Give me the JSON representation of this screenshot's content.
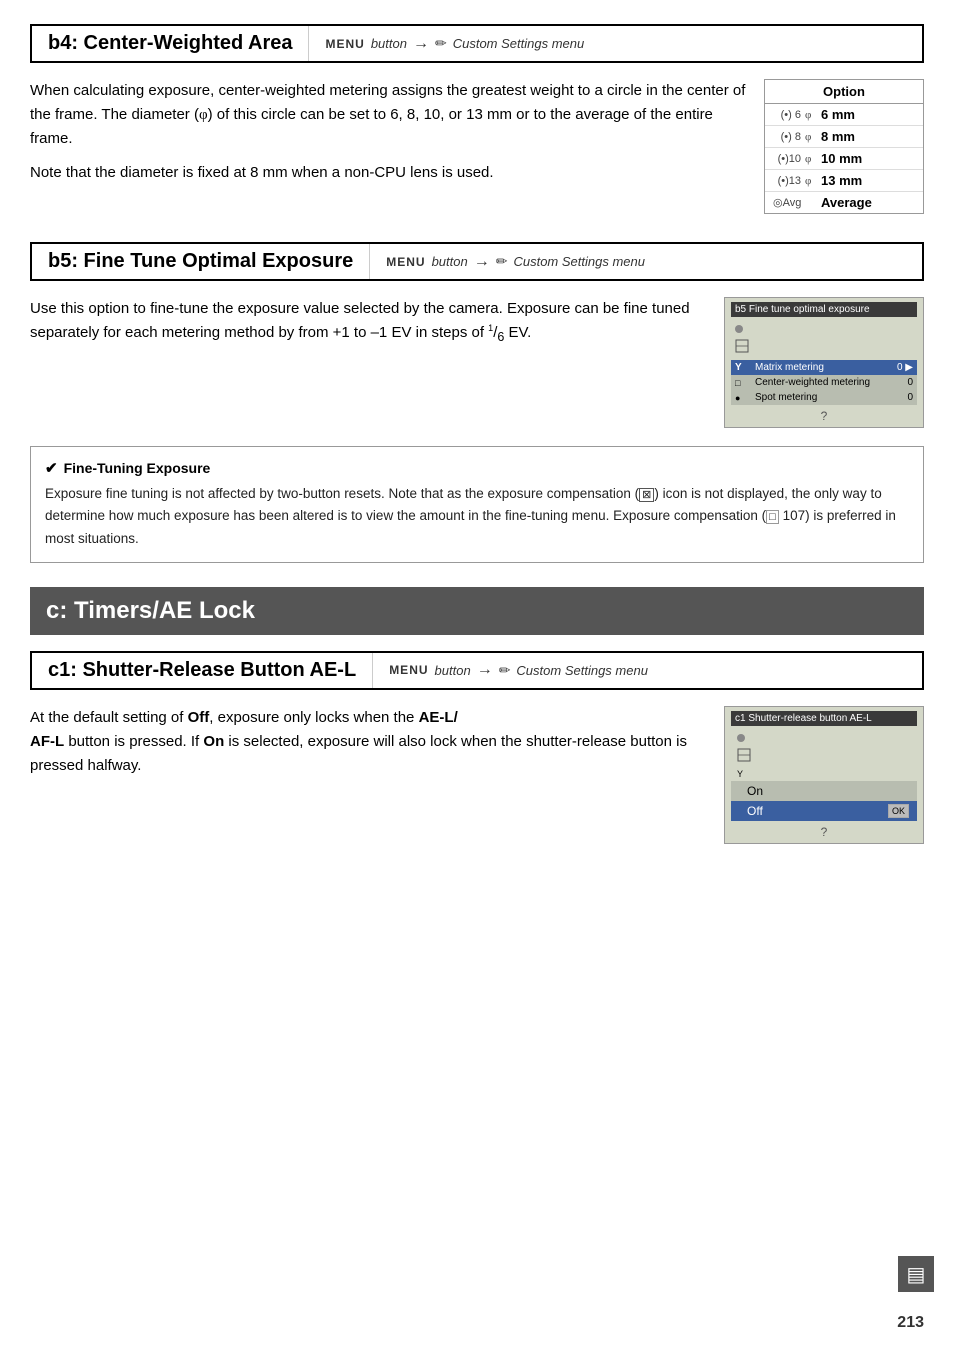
{
  "b4": {
    "title": "b4: Center-Weighted Area",
    "nav": {
      "menu": "MENU",
      "button": "button",
      "arrow": "→",
      "section": "Custom Settings menu"
    },
    "body1": "When calculating exposure, center-weighted metering assigns the greatest weight to a circle in the center of the frame.  The diameter (φ) of this circle can be set to 6, 8, 10, or 13 mm or to the average of the entire frame.",
    "body2": "Note that the diameter is fixed at 8 mm when a non-CPU lens is used.",
    "option_header": "Option",
    "options": [
      {
        "sym": "(•) 6",
        "phi": "φ",
        "val": "6 mm"
      },
      {
        "sym": "(•) 8",
        "phi": "φ",
        "val": "8 mm"
      },
      {
        "sym": "(•)10",
        "phi": "φ",
        "val": "10 mm"
      },
      {
        "sym": "(•)13",
        "phi": "φ",
        "val": "13 mm"
      },
      {
        "sym": "◎Avg",
        "phi": "",
        "val": "Average"
      }
    ]
  },
  "b5": {
    "title": "b5: Fine Tune Optimal Exposure",
    "nav": {
      "menu": "MENU",
      "button": "button",
      "arrow": "→",
      "section": "Custom Settings menu"
    },
    "body": "Use this option to fine-tune the exposure value selected by the camera.  Exposure can be fine tuned separately for each metering method by from +1 to –1 EV in steps of",
    "fraction": "1/6",
    "body2": " EV.",
    "lcd": {
      "title": "b5 Fine tune optimal exposure",
      "rows": [
        {
          "icon": "Y",
          "label": "Matrix metering",
          "val": "0",
          "has_arrow": true
        },
        {
          "icon": "□",
          "label": "Center-weighted metering",
          "val": "0"
        },
        {
          "icon": "●",
          "label": "Spot metering",
          "val": "0"
        }
      ]
    }
  },
  "note": {
    "title": "Fine-Tuning Exposure",
    "text": "Exposure fine tuning is not affected by two-button resets.  Note that as the exposure compensation (⊠) icon is not displayed, the only way to determine how much exposure has been altered is to view the amount in the fine-tuning menu.  Exposure compensation (□ 107) is preferred in most situations."
  },
  "c_section": {
    "title": "c: Timers/AE Lock"
  },
  "c1": {
    "title": "c1: Shutter-Release Button AE-L",
    "nav": {
      "menu": "MENU",
      "button": "button",
      "arrow": "→",
      "section": "Custom Settings menu"
    },
    "body": "At the default setting of",
    "off_bold": "Off",
    "body2": ", exposure only locks when the",
    "ael": "AE-L/",
    "afl": "AF-L",
    "body3": " button is pressed.  If",
    "on_bold": "On",
    "body4": " is selected, exposure will also lock when the shutter-release button is pressed halfway.",
    "lcd": {
      "title": "c1 Shutter-release button AE-L",
      "options": [
        {
          "label": "On",
          "selected": false
        },
        {
          "label": "Off",
          "selected": true,
          "ok": true
        }
      ]
    }
  },
  "page_number": "213"
}
